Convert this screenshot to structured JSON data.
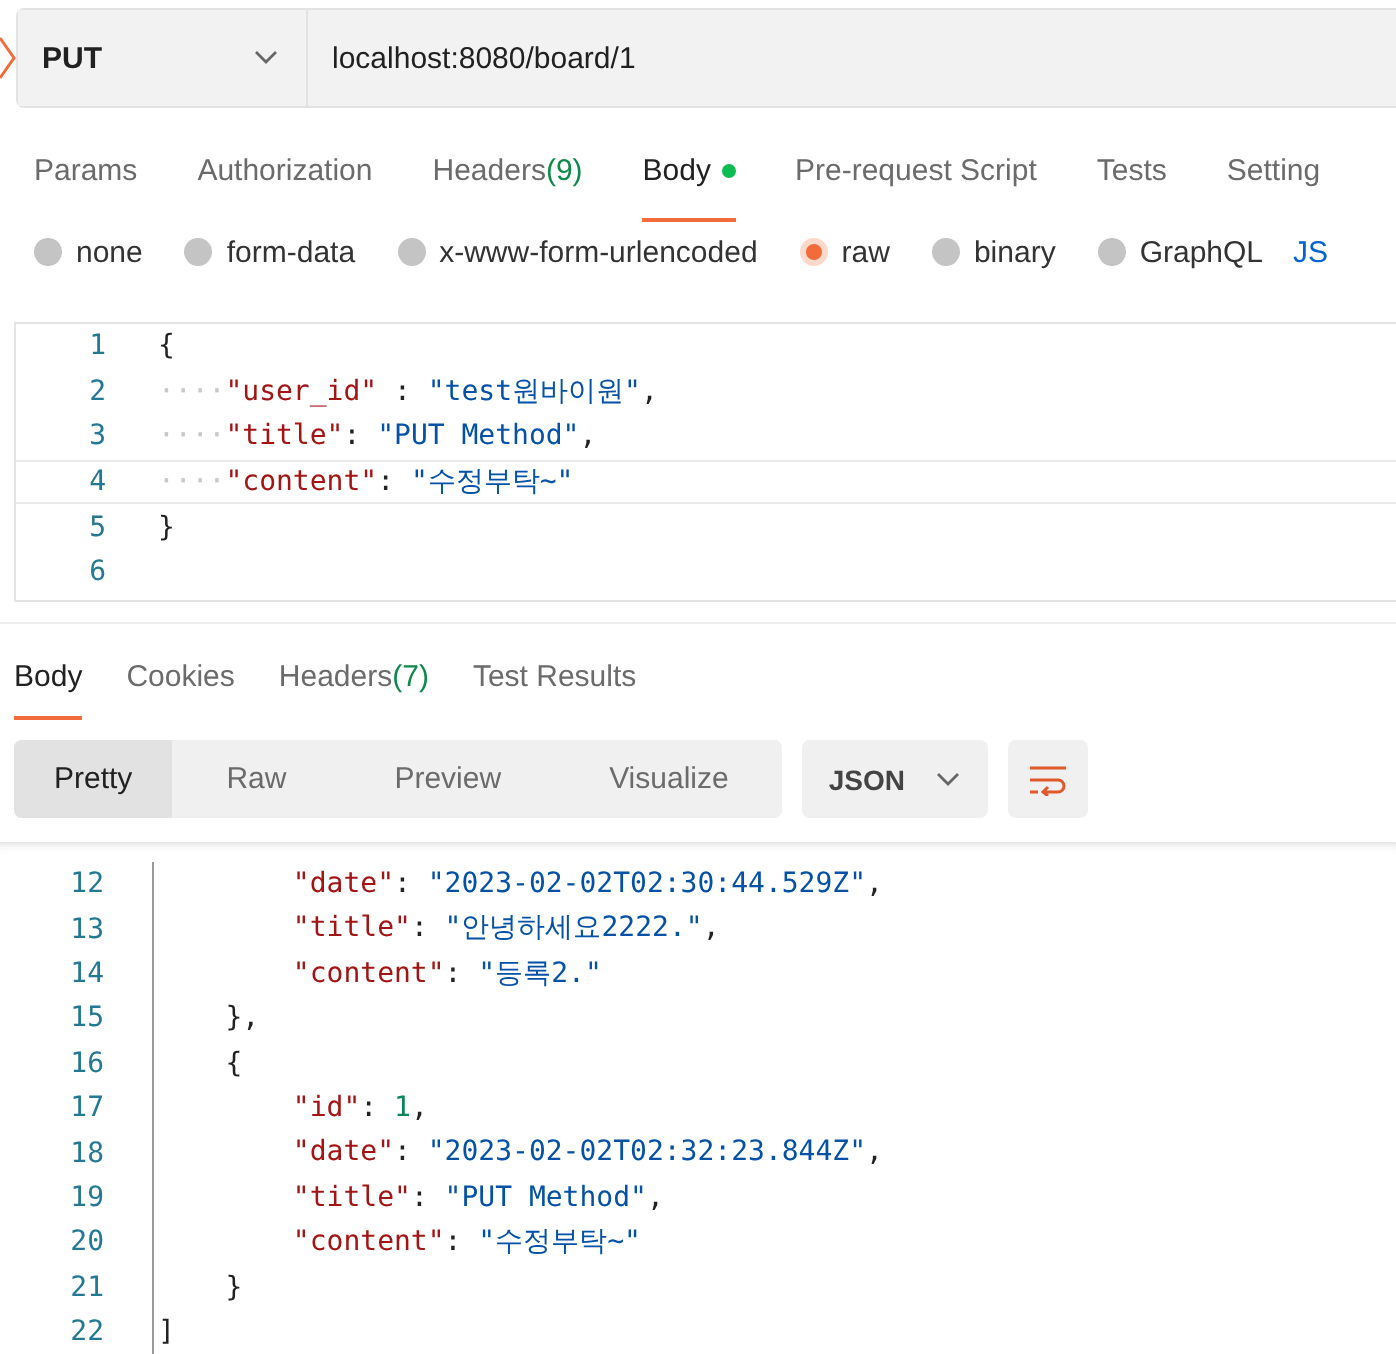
{
  "request": {
    "method": "PUT",
    "url": "localhost:8080/board/1"
  },
  "request_tabs": [
    {
      "label": "Params",
      "selected": false
    },
    {
      "label": "Authorization",
      "selected": false
    },
    {
      "label": "Headers",
      "count": "(9)",
      "selected": false
    },
    {
      "label": "Body",
      "selected": true,
      "dot": true
    },
    {
      "label": "Pre-request Script",
      "selected": false
    },
    {
      "label": "Tests",
      "selected": false
    },
    {
      "label": "Setting",
      "selected": false
    }
  ],
  "body_types": [
    {
      "label": "none",
      "selected": false
    },
    {
      "label": "form-data",
      "selected": false
    },
    {
      "label": "x-www-form-urlencoded",
      "selected": false
    },
    {
      "label": "raw",
      "selected": true
    },
    {
      "label": "binary",
      "selected": false
    },
    {
      "label": "GraphQL",
      "selected": false
    }
  ],
  "body_format": "JS",
  "request_body": [
    {
      "number": "1",
      "segments": [
        {
          "kind": "punct",
          "text": "{"
        }
      ]
    },
    {
      "number": "2",
      "segments": [
        {
          "kind": "space",
          "text": "····"
        },
        {
          "kind": "key",
          "text": "\"user_id\""
        },
        {
          "kind": "punct",
          "text": " : "
        },
        {
          "kind": "string",
          "text": "\"test원바이원\""
        },
        {
          "kind": "punct",
          "text": ","
        }
      ]
    },
    {
      "number": "3",
      "segments": [
        {
          "kind": "space",
          "text": "····"
        },
        {
          "kind": "key",
          "text": "\"title\""
        },
        {
          "kind": "punct",
          "text": ": "
        },
        {
          "kind": "string",
          "text": "\"PUT Method\""
        },
        {
          "kind": "punct",
          "text": ","
        }
      ]
    },
    {
      "number": "4",
      "current": true,
      "segments": [
        {
          "kind": "space",
          "text": "····"
        },
        {
          "kind": "key",
          "text": "\"content\""
        },
        {
          "kind": "punct",
          "text": ": "
        },
        {
          "kind": "string",
          "text": "\"수정부탁~\""
        }
      ]
    },
    {
      "number": "5",
      "segments": [
        {
          "kind": "punct",
          "text": "}"
        }
      ]
    },
    {
      "number": "6"
    }
  ],
  "response_tabs": [
    {
      "label": "Body",
      "selected": true
    },
    {
      "label": "Cookies",
      "selected": false
    },
    {
      "label": "Headers",
      "count": "(7)",
      "selected": false
    },
    {
      "label": "Test Results",
      "selected": false
    }
  ],
  "view_modes": [
    {
      "label": "Pretty",
      "selected": true
    },
    {
      "label": "Raw",
      "selected": false
    },
    {
      "label": "Preview",
      "selected": false
    },
    {
      "label": "Visualize",
      "selected": false
    }
  ],
  "response_format": "JSON",
  "response_body": [
    {
      "number": "12",
      "segments": [
        {
          "kind": "key",
          "text": "        \"date\""
        },
        {
          "kind": "punct",
          "text": ": "
        },
        {
          "kind": "string",
          "text": "\"2023-02-02T02:30:44.529Z\""
        },
        {
          "kind": "punct",
          "text": ","
        }
      ]
    },
    {
      "number": "13",
      "segments": [
        {
          "kind": "key",
          "text": "        \"title\""
        },
        {
          "kind": "punct",
          "text": ": "
        },
        {
          "kind": "string",
          "text": "\"안녕하세요2222.\""
        },
        {
          "kind": "punct",
          "text": ","
        }
      ]
    },
    {
      "number": "14",
      "segments": [
        {
          "kind": "key",
          "text": "        \"content\""
        },
        {
          "kind": "punct",
          "text": ": "
        },
        {
          "kind": "string",
          "text": "\"등록2.\""
        }
      ]
    },
    {
      "number": "15",
      "segments": [
        {
          "kind": "punct",
          "text": "    },"
        }
      ]
    },
    {
      "number": "16",
      "segments": [
        {
          "kind": "punct",
          "text": "    {"
        }
      ]
    },
    {
      "number": "17",
      "segments": [
        {
          "kind": "key",
          "text": "        \"id\""
        },
        {
          "kind": "punct",
          "text": ": "
        },
        {
          "kind": "number",
          "text": "1"
        },
        {
          "kind": "punct",
          "text": ","
        }
      ]
    },
    {
      "number": "18",
      "segments": [
        {
          "kind": "key",
          "text": "        \"date\""
        },
        {
          "kind": "punct",
          "text": ": "
        },
        {
          "kind": "string",
          "text": "\"2023-02-02T02:32:23.844Z\""
        },
        {
          "kind": "punct",
          "text": ","
        }
      ]
    },
    {
      "number": "19",
      "segments": [
        {
          "kind": "key",
          "text": "        \"title\""
        },
        {
          "kind": "punct",
          "text": ": "
        },
        {
          "kind": "string",
          "text": "\"PUT Method\""
        },
        {
          "kind": "punct",
          "text": ","
        }
      ]
    },
    {
      "number": "20",
      "segments": [
        {
          "kind": "key",
          "text": "        \"content\""
        },
        {
          "kind": "punct",
          "text": ": "
        },
        {
          "kind": "string",
          "text": "\"수정부탁~\""
        }
      ]
    },
    {
      "number": "21",
      "segments": [
        {
          "kind": "punct",
          "text": "    }"
        }
      ]
    },
    {
      "number": "22",
      "segments": [
        {
          "kind": "punct",
          "text": "]"
        }
      ]
    }
  ]
}
